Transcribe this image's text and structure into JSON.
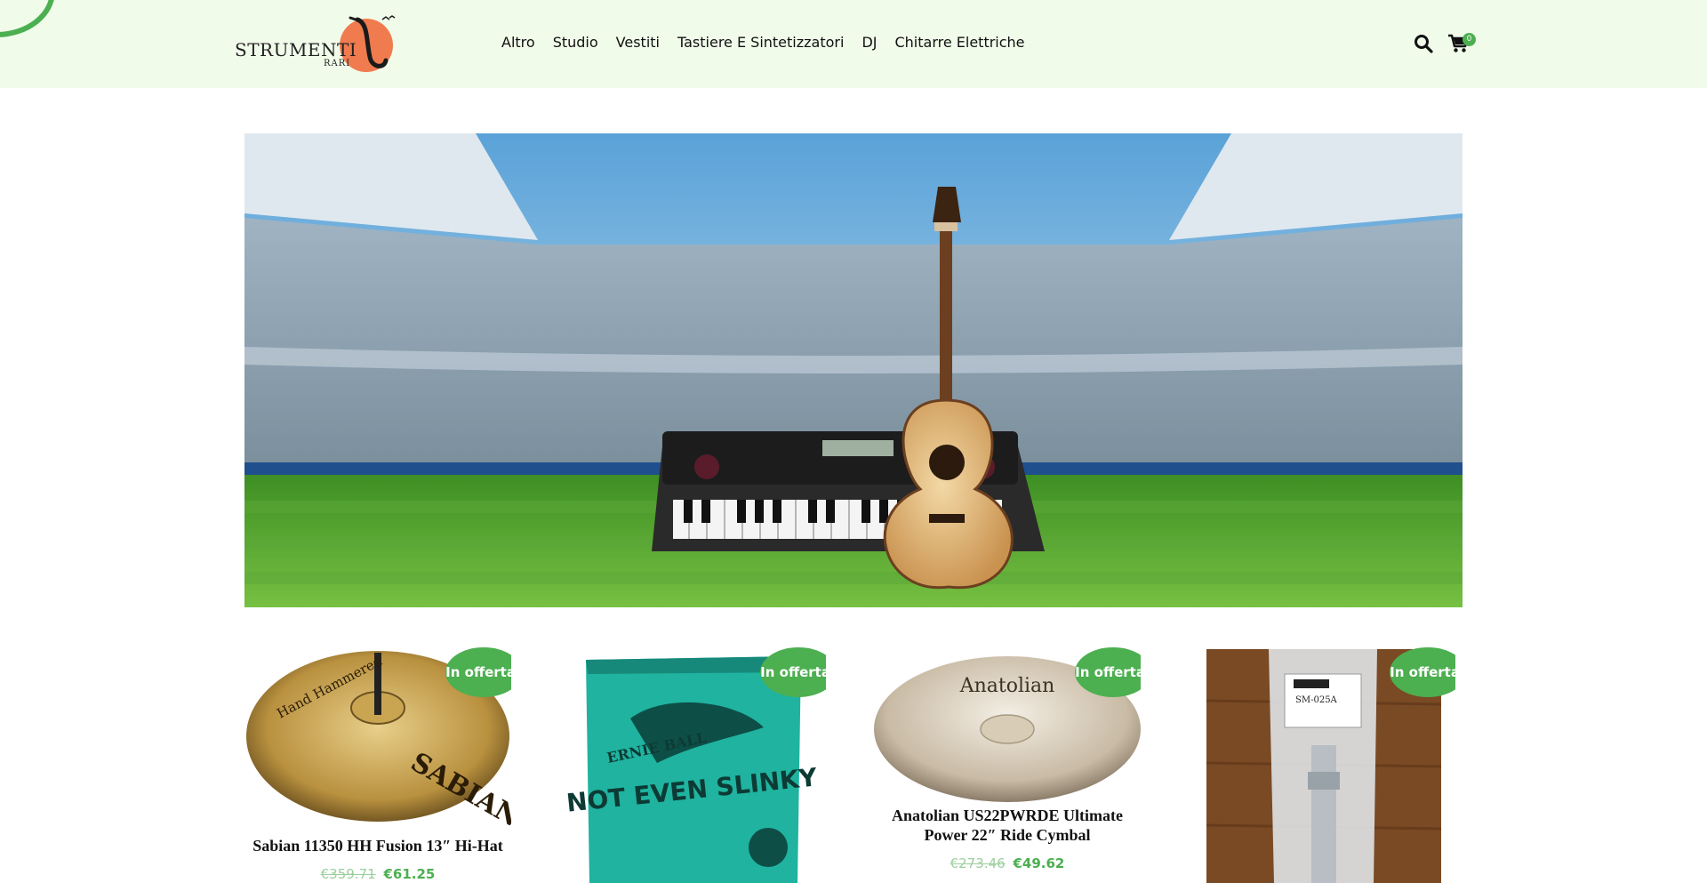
{
  "header": {
    "logo_main": "STRUMENTI",
    "logo_sub": "RARI",
    "nav": [
      "Altro",
      "Studio",
      "Vestiti",
      "Tastiere E Sintetizzatori",
      "DJ",
      "Chitarre Elettriche"
    ],
    "cart_count": "0"
  },
  "colors": {
    "accent": "#4caf50",
    "header_bg": "#f1fbea",
    "logo_orange": "#f07b4f"
  },
  "products": [
    {
      "badge": "In offerta!",
      "title": "Sabian 11350 HH Fusion 13″ Hi-Hat",
      "old_price": "€359.71",
      "new_price": "€61.25"
    },
    {
      "badge": "In offerta!",
      "title": "",
      "old_price": "",
      "new_price": ""
    },
    {
      "badge": "In offerta!",
      "title": "Anatolian US22PWRDE Ultimate Power 22″ Ride Cymbal",
      "old_price": "€273.46",
      "new_price": "€49.62"
    },
    {
      "badge": "In offerta!",
      "title": "",
      "old_price": "",
      "new_price": ""
    }
  ],
  "product_art": {
    "p0_text": "SABIAN",
    "p0_text2": "Hand Hammered",
    "p1_text": "NOT EVEN SLINKY",
    "p1_text2": "ERNIE BALL",
    "p2_text": "Anatolian",
    "p3_text": "SM-025A"
  }
}
